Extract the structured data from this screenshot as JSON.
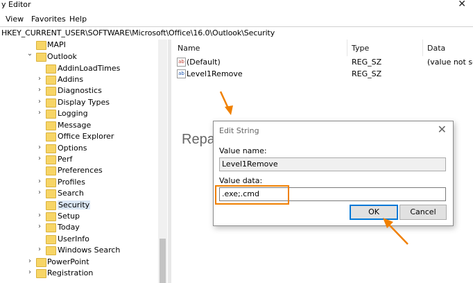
{
  "window": {
    "title": "y Editor",
    "close_glyph": "✕"
  },
  "menu": {
    "items": [
      "View",
      "Favorites",
      "Help"
    ]
  },
  "address": {
    "path": "HKEY_CURRENT_USER\\SOFTWARE\\Microsoft\\Office\\16.0\\Outlook\\Security"
  },
  "tree": {
    "items": [
      {
        "label": "MAPI",
        "expanded": false,
        "chevron": ""
      },
      {
        "label": "Outlook",
        "expanded": true,
        "chevron": "⌄"
      },
      {
        "label": "AddinLoadTimes",
        "chevron": ""
      },
      {
        "label": "Addins",
        "chevron": "›"
      },
      {
        "label": "Diagnostics",
        "chevron": "›"
      },
      {
        "label": "Display Types",
        "chevron": "›"
      },
      {
        "label": "Logging",
        "chevron": "›"
      },
      {
        "label": "Message",
        "chevron": ""
      },
      {
        "label": "Office Explorer",
        "chevron": ""
      },
      {
        "label": "Options",
        "chevron": "›"
      },
      {
        "label": "Perf",
        "chevron": "›"
      },
      {
        "label": "Preferences",
        "chevron": ""
      },
      {
        "label": "Profiles",
        "chevron": "›"
      },
      {
        "label": "Search",
        "chevron": "›"
      },
      {
        "label": "Security",
        "chevron": "",
        "selected": true
      },
      {
        "label": "Setup",
        "chevron": "›"
      },
      {
        "label": "Today",
        "chevron": "›"
      },
      {
        "label": "UserInfo",
        "chevron": ""
      },
      {
        "label": "Windows Search",
        "chevron": "›"
      },
      {
        "label": "PowerPoint",
        "chevron": "›"
      },
      {
        "label": "Registration",
        "chevron": "›"
      }
    ]
  },
  "list": {
    "headers": {
      "name": "Name",
      "type": "Type",
      "data": "Data"
    },
    "rows": [
      {
        "name": "(Default)",
        "type": "REG_SZ",
        "data": "(value not se"
      },
      {
        "name": "Level1Remove",
        "type": "REG_SZ",
        "data": ""
      }
    ]
  },
  "watermark": "RepairWin.com",
  "dialog": {
    "title": "Edit String",
    "close_glyph": "✕",
    "value_name_label": "Value name:",
    "value_name": "Level1Remove",
    "value_data_label": "Value data:",
    "value_data": ".exe;.cmd",
    "ok_label": "OK",
    "cancel_label": "Cancel"
  },
  "colors": {
    "annotation": "#f08000",
    "folder": "#f7d566",
    "selection": "#dbe7f5",
    "focus": "#0078d7"
  },
  "icons": [
    "close-icon",
    "folder-icon",
    "chevron-right-icon",
    "chevron-down-icon",
    "string-value-icon",
    "binary-value-icon"
  ]
}
